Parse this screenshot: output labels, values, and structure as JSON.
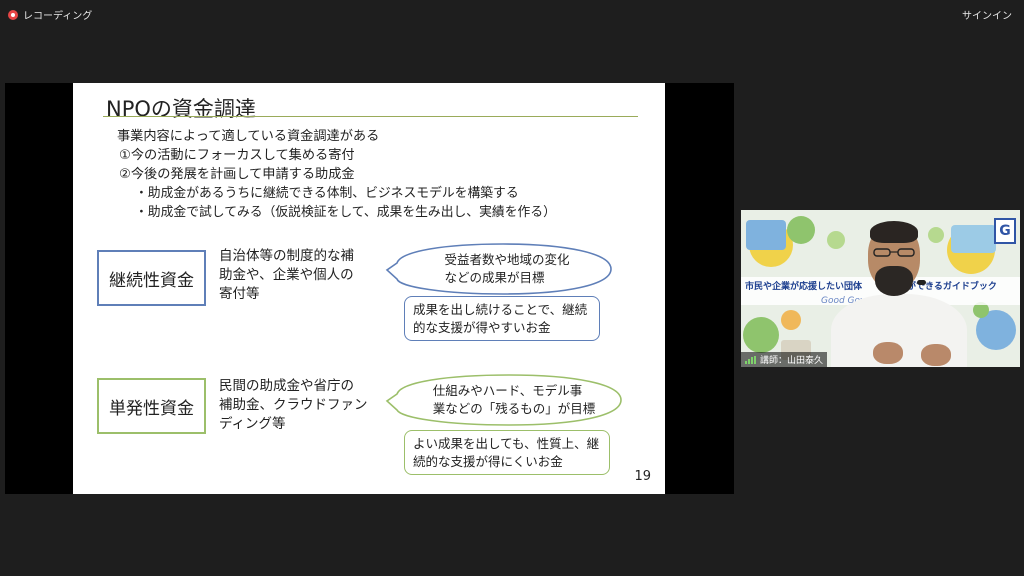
{
  "topbar": {
    "recording_label": "レコーディング",
    "signin_label": "サインイン"
  },
  "slide": {
    "title": "NPOの資金調達",
    "lines": [
      "事業内容によって適している資金調達がある",
      "①今の活動にフォーカスして集める寄付",
      "②今後の発展を計画して申請する助成金",
      "・助成金があるうちに継続できる体制、ビジネスモデルを構築する",
      "・助成金で試してみる（仮説検証をして、成果を生み出し、実績を作る）"
    ],
    "continuous": {
      "label": "継続性資金",
      "desc": [
        "自治体等の制度的な補",
        "助金や、企業や個人の",
        "寄付等"
      ],
      "bubble": [
        "受益者数や地域の変化",
        "などの成果が目標"
      ],
      "note": [
        "成果を出し続けることで、継続",
        "的な支援が得やすいお金"
      ]
    },
    "single": {
      "label": "単発性資金",
      "desc": [
        "民間の助成金や省庁の",
        "補助金、クラウドファン",
        "ディング等"
      ],
      "bubble": [
        "仕組みやハード、モデル事",
        "業などの「残るもの」が目標"
      ],
      "note": [
        "よい成果を出しても、性質上、継",
        "続的な支援が得にくいお金"
      ]
    },
    "page_number": "19"
  },
  "video": {
    "banner_title": "市民や企業が応援したい団体　　　　　ができるガイドブック",
    "banner_sub": "Good Gov　　　　　ce",
    "logo_letter": "G",
    "participant_name": "講師：山田泰久"
  },
  "colors": {
    "blue_border": "#5f7fb8",
    "green_border": "#9cbf6a",
    "title_rule": "#9aab5a",
    "background": "#1e1e1e"
  }
}
